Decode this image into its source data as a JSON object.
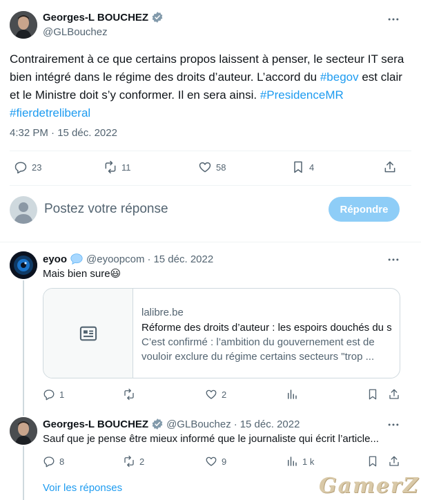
{
  "main_tweet": {
    "author_name": "Georges-L BOUCHEZ",
    "author_handle": "@GLBouchez",
    "text_part1": "Contrairement à ce que certains propos laissent à penser, le secteur IT sera bien intégré dans le régime des droits d’auteur. L’accord du ",
    "hashtag1": "#begov",
    "text_part2": " est clair et le Ministre doit s’y conformer. Il en sera ainsi. ",
    "hashtag2": "#PresidenceMR",
    "hashtag3": "#fierdetreliberal",
    "timestamp": "4:32 PM · 15 déc. 2022",
    "replies": "23",
    "retweets": "11",
    "likes": "58",
    "bookmarks": "4"
  },
  "compose": {
    "placeholder": "Postez votre réponse",
    "button": "Répondre"
  },
  "reply1": {
    "author_name": "eyoo",
    "author_handle": "@eyoopcom",
    "date": "15 déc. 2022",
    "text": "Mais bien sure",
    "emoji": "😃",
    "card": {
      "domain": "lalibre.be",
      "title": "Réforme des droits d’auteur : les espoirs douchés du se",
      "desc1": "C’est confirmé : l’ambition du gouvernement est de",
      "desc2": "vouloir exclure du régime certains secteurs \"trop ..."
    },
    "replies": "1",
    "retweets": "",
    "likes": "2",
    "views": ""
  },
  "reply2": {
    "author_name": "Georges-L BOUCHEZ",
    "author_handle": "@GLBouchez",
    "date": "15 déc. 2022",
    "text": "Sauf que je pense être mieux informé que le journaliste qui écrit l’article...",
    "replies": "8",
    "retweets": "2",
    "likes": "9",
    "views": "1 k"
  },
  "show_replies": "Voir les réponses",
  "separator": "·",
  "watermark": "GamerZ",
  "colors": {
    "accent": "#1d9bf0",
    "text": "#0f1419",
    "muted": "#536471",
    "verified": "#829aab",
    "reply_button": "#8ecdf7"
  },
  "icons": [
    "verified-badge-icon",
    "more-icon",
    "reply-icon",
    "retweet-icon",
    "like-icon",
    "bookmark-icon",
    "share-icon",
    "views-icon",
    "article-icon",
    "speech-bubble-badge-icon"
  ]
}
